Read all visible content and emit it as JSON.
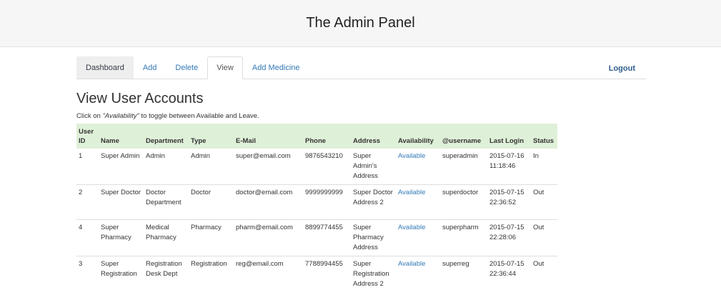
{
  "header": {
    "title": "The Admin Panel"
  },
  "nav": {
    "tabs": [
      {
        "label": "Dashboard"
      },
      {
        "label": "Add"
      },
      {
        "label": "Delete"
      },
      {
        "label": "View"
      },
      {
        "label": "Add Medicine"
      }
    ],
    "logout": "Logout"
  },
  "page": {
    "title": "View User Accounts",
    "hint_prefix": "Click on ",
    "hint_emph": "\"Availability\"",
    "hint_suffix": " to toggle between Available and Leave."
  },
  "table": {
    "headers": [
      "User ID",
      "Name",
      "Department",
      "Type",
      "E-Mail",
      "Phone",
      "Address",
      "Availability",
      "@username",
      "Last Login",
      "Status"
    ],
    "rows": [
      [
        "1",
        "Super Admin",
        "Admin",
        "Admin",
        "super@email.com",
        "9876543210",
        "Super Admin's Address",
        "Available",
        "superadmin",
        "2015-07-16 11:18:46",
        "In"
      ],
      [
        "2",
        "Super Doctor",
        "Doctor Department",
        "Doctor",
        "doctor@email.com",
        "9999999999",
        "Super Doctor Address 2",
        "Available",
        "superdoctor",
        "2015-07-15 22:36:52",
        "Out"
      ],
      [
        "4",
        "Super Pharmacy",
        "Medical Pharmacy",
        "Pharmacy",
        "pharm@email.com",
        "8899774455",
        "Super Pharmacy Address",
        "Available",
        "superpharm",
        "2015-07-15 22:28:06",
        "Out"
      ],
      [
        "3",
        "Super Registration",
        "Registration Desk Dept",
        "Registration",
        "reg@email.com",
        "7788994455",
        "Super Registration Address 2",
        "Available",
        "superreg",
        "2015-07-15 22:36:44",
        "Out"
      ]
    ]
  },
  "colors": {
    "header_bg": "#f6f6f6",
    "table_header_bg": "#dff0d8",
    "link": "#337ab7"
  }
}
